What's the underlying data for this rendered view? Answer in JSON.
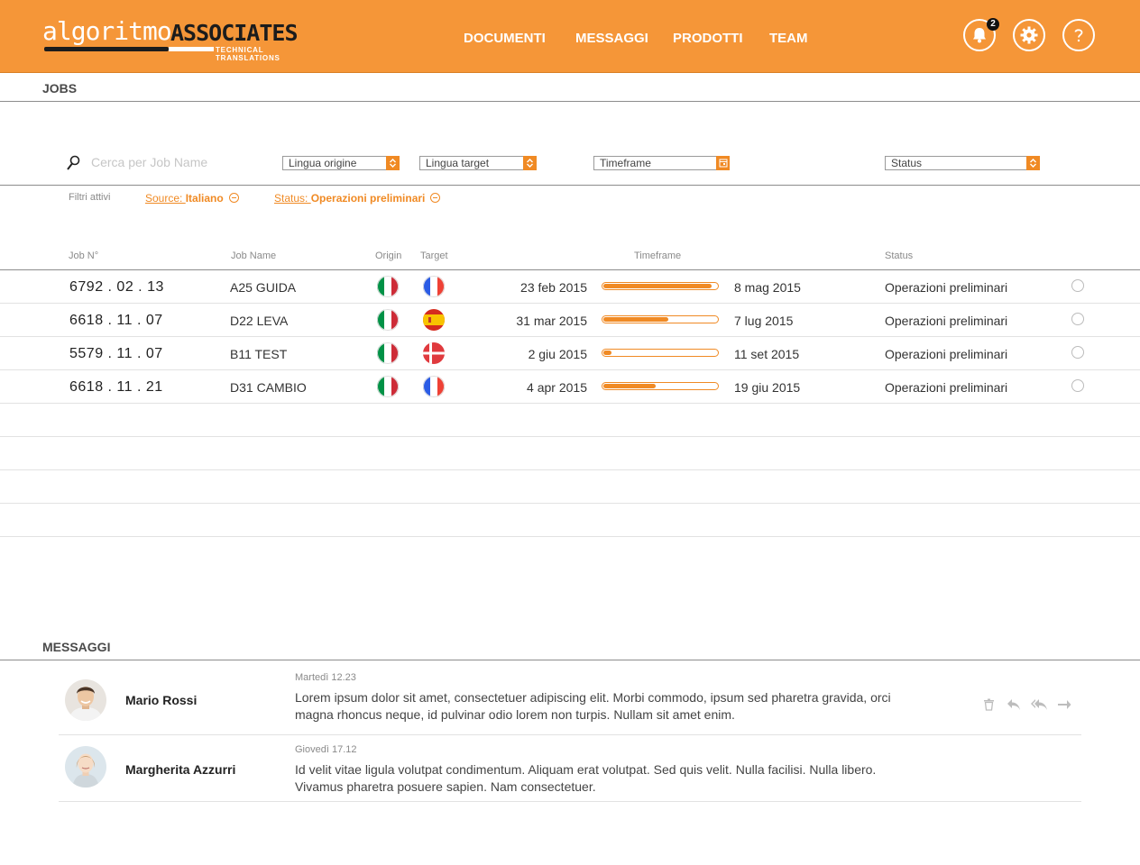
{
  "brand": {
    "name_light": "algoritmo",
    "name_bold": "ASSOCIATES",
    "tagline": "TECHNICAL TRANSLATIONS"
  },
  "colors": {
    "accent": "#f59638",
    "accent_dark": "#f08a24"
  },
  "nav": [
    "DOCUMENTI",
    "MESSAGGI",
    "PRODOTTI",
    "TEAM"
  ],
  "header_icons": {
    "notifications": "bell-icon",
    "notification_count": "2",
    "settings": "gear-icon",
    "help": "help-icon"
  },
  "jobs": {
    "title": "JOBS",
    "search_placeholder": "Cerca per Job Name",
    "filters": {
      "source_lang": "Lingua origine",
      "target_lang": "Lingua target",
      "timeframe": "Timeframe",
      "status": "Status"
    },
    "active_filters": {
      "label": "Filtri attivi",
      "chips": [
        {
          "key": "Source: ",
          "value": "Italiano"
        },
        {
          "key": "Status: ",
          "value": "Operazioni preliminari"
        }
      ]
    },
    "columns": {
      "job_no": "Job N°",
      "job_name": "Job Name",
      "origin": "Origin",
      "target": "Target",
      "timeframe": "Timeframe",
      "status": "Status"
    },
    "rows": [
      {
        "job_no": "6792 . 02 . 13",
        "job_name": "A25 GUIDA",
        "origin": "it",
        "target": "fr",
        "start": "23 feb 2015",
        "progress": 0.95,
        "end": "8 mag 2015",
        "status": "Operazioni preliminari"
      },
      {
        "job_no": "6618 . 11 . 07",
        "job_name": "D22 LEVA",
        "origin": "it",
        "target": "es",
        "start": "31 mar 2015",
        "progress": 0.57,
        "end": "7 lug 2015",
        "status": "Operazioni preliminari"
      },
      {
        "job_no": "5579 . 11 . 07",
        "job_name": "B11 TEST",
        "origin": "it",
        "target": "dk",
        "start": "2 giu 2015",
        "progress": 0.07,
        "end": "11 set 2015",
        "status": "Operazioni preliminari"
      },
      {
        "job_no": "6618 . 11 . 21",
        "job_name": "D31 CAMBIO",
        "origin": "it",
        "target": "fr",
        "start": "4 apr 2015",
        "progress": 0.46,
        "end": "19 giu 2015",
        "status": "Operazioni preliminari"
      }
    ]
  },
  "messages": {
    "title": "MESSAGGI",
    "items": [
      {
        "sender": "Mario Rossi",
        "date": "Martedì 12.23",
        "text": "Lorem ipsum dolor sit amet, consectetuer adipiscing elit. Morbi commodo, ipsum sed pharetra gravida, orci magna rhoncus neque, id pulvinar odio lorem non turpis. Nullam sit amet enim."
      },
      {
        "sender": "Margherita Azzurri",
        "date": "Giovedì 17.12",
        "text": "Id velit vitae ligula volutpat condimentum. Aliquam erat volutpat. Sed quis velit. Nulla facilisi. Nulla libero. Vivamus pharetra posuere sapien. Nam consectetuer."
      }
    ],
    "actions": [
      "trash-icon",
      "reply-icon",
      "reply-all-icon",
      "forward-icon"
    ]
  }
}
